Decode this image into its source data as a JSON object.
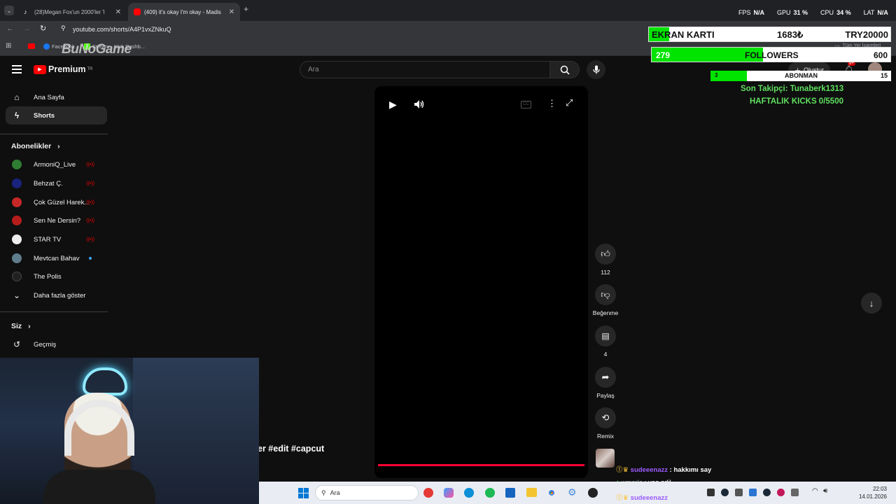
{
  "colors": {
    "accent": "#ff0000",
    "overlay_green": "#00e400",
    "chat_name": "#9b5cff"
  },
  "browser": {
    "tabs": [
      {
        "title": "(28)Megan Fox'un 2000'ler Tarz",
        "icon": "tiktok-icon"
      },
      {
        "title": "(409) it's okay I'm okay - Madis",
        "icon": "youtube-icon"
      }
    ],
    "new_tab": "+",
    "url": "youtube.com/shorts/A4P1vxZNkuQ",
    "bookmarks": [
      {
        "label": "Facebook",
        "icon": "facebook-icon"
      },
      {
        "label": "Stream - Kick Dashb...",
        "icon": "kick-icon"
      }
    ],
    "all_bookmarks": "Tüm Yer İşaretleri"
  },
  "overlay_top": {
    "fps_label": "FPS",
    "fps_value": "N/A",
    "gpu_label": "GPU",
    "gpu_value": "31 %",
    "cpu_label": "CPU",
    "cpu_value": "34 %",
    "lat_label": "LAT",
    "lat_value": "N/A",
    "watermark": "BuNoGame"
  },
  "overlay_goals": {
    "ekran_label": "EKRAN KARTI",
    "ekran_current": "1683₺",
    "ekran_goal": "TRY20000",
    "ekran_progress": 0.084,
    "followers_current": "279",
    "followers_label": "FOLLOWERS",
    "followers_goal": "600",
    "followers_progress": 0.465,
    "sub_current": "3",
    "sub_label": "ABONMAN",
    "sub_goal": "15",
    "sub_progress": 0.2,
    "last_follower": "Son Takipçi: Tunaberk1313",
    "weekly_kicks": "HAFTALIK KICKS 0/5500"
  },
  "youtube": {
    "logo_text": "Premium",
    "logo_sup": "TR",
    "search_placeholder": "Ara",
    "create_label": "Oluştur",
    "notif_badge": "9+",
    "sidebar": {
      "home": "Ana Sayfa",
      "shorts": "Shorts",
      "subs_title": "Abonelikler",
      "channels": [
        {
          "name": "ArmoniQ_Live",
          "live": true,
          "color": "#2e7d32"
        },
        {
          "name": "Behzat Ç.",
          "live": true,
          "color": "#1a237e"
        },
        {
          "name": "Çok Güzel Harek...",
          "live": true,
          "color": "#c62828"
        },
        {
          "name": "Sen Ne Dersin?",
          "live": true,
          "color": "#b71c1c"
        },
        {
          "name": "STAR TV",
          "live": true,
          "color": "#eeeeee"
        },
        {
          "name": "Mevtcan Bahav",
          "live": false,
          "dot": true,
          "color": "#607d8b"
        },
        {
          "name": "The Polis",
          "live": false,
          "color": "#212121"
        }
      ],
      "more": "Daha fazla göster",
      "you_title": "Siz",
      "history": "Geçmiş"
    },
    "actions": {
      "likes": "112",
      "dislike": "Beğenme",
      "comments": "4",
      "share": "Paylaş",
      "remix": "Remix"
    },
    "caption": "er #edit #capcut",
    "progress": 1.0
  },
  "chat": [
    {
      "user": "sudeeenazz",
      "msg": ": hakkımı say"
    },
    {
      "user": "wmorla",
      "msg": ": yoo adil"
    },
    {
      "user": "sudeeenazz",
      "msg": ""
    }
  ],
  "taskbar": {
    "search": "Ara",
    "time": "22:03",
    "date": "14.01.2026"
  }
}
